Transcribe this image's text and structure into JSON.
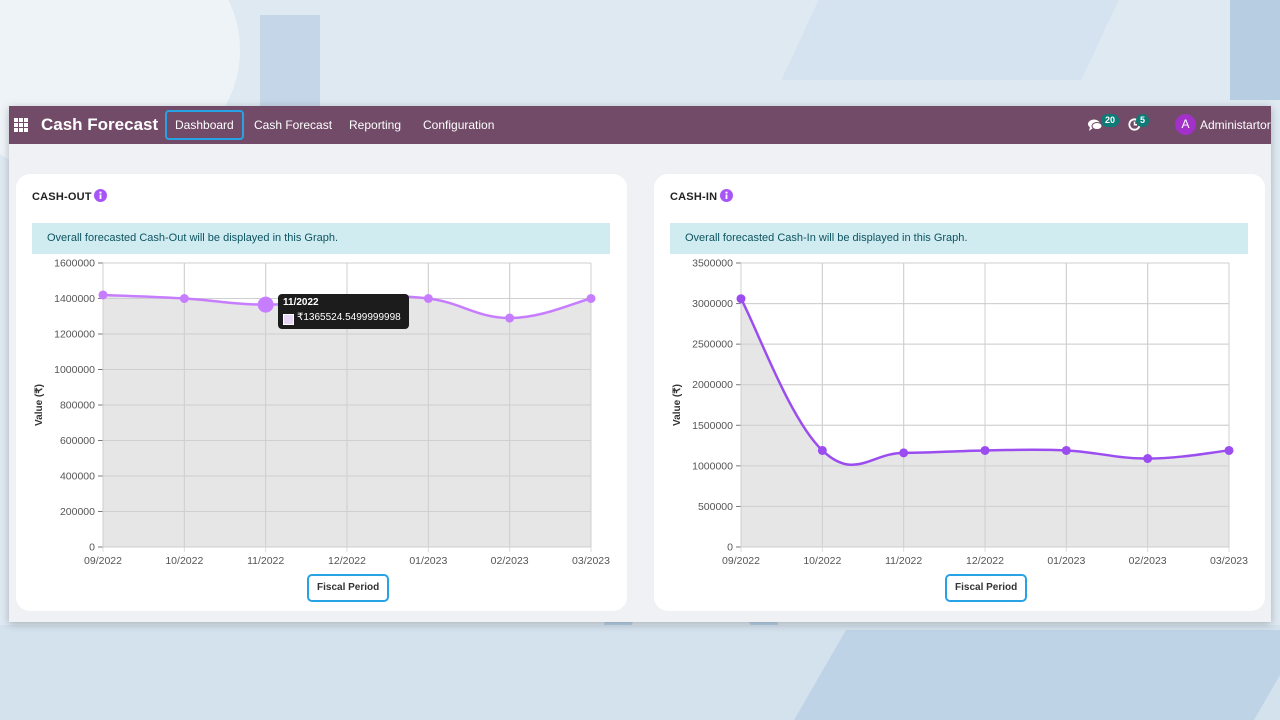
{
  "navbar": {
    "app_title": "Cash Forecast",
    "menu": [
      {
        "label": "Dashboard",
        "active": true
      },
      {
        "label": "Cash Forecast",
        "active": false
      },
      {
        "label": "Reporting",
        "active": false
      },
      {
        "label": "Configuration",
        "active": false
      }
    ],
    "messages_count": "20",
    "activities_count": "5",
    "user_initial": "A",
    "user_name": "Administartor",
    "bar_color": "#714b67",
    "avatar_color": "#a230c9",
    "badge_color": "#0d7b76"
  },
  "cash_out": {
    "title": "CASH-OUT",
    "info_icon": "info-circle-icon",
    "alert": "Overall forecasted Cash-Out will be displayed in this Graph.",
    "tooltip": {
      "title": "11/2022",
      "value": "₹1365524.5499999998"
    }
  },
  "cash_in": {
    "title": "CASH-IN",
    "info_icon": "info-circle-icon",
    "alert": "Overall forecasted Cash-In will be displayed in this Graph."
  },
  "chart_data": [
    {
      "type": "line",
      "x": [
        "09/2022",
        "10/2022",
        "11/2022",
        "12/2022",
        "01/2023",
        "02/2023",
        "03/2023"
      ],
      "values": [
        1420000,
        1400000,
        1365524.55,
        1400000,
        1400000,
        1290000,
        1400000
      ],
      "xlabel": "Fiscal Period",
      "ylabel": "Value (₹)",
      "ylim": [
        0,
        1600000
      ],
      "yticks": [
        0,
        200000,
        400000,
        600000,
        800000,
        1000000,
        1200000,
        1400000,
        1600000
      ],
      "line_color": "#c77dff",
      "fill_color": "#e3e3e3",
      "grid": true
    },
    {
      "type": "line",
      "x": [
        "09/2022",
        "10/2022",
        "11/2022",
        "12/2022",
        "01/2023",
        "02/2023",
        "03/2023"
      ],
      "values": [
        3060000,
        1190000,
        1160000,
        1190000,
        1190000,
        1090000,
        1190000
      ],
      "xlabel": "Fiscal Period",
      "ylabel": "Value (₹)",
      "ylim": [
        0,
        3500000
      ],
      "yticks": [
        0,
        500000,
        1000000,
        1500000,
        2000000,
        2500000,
        3000000,
        3500000
      ],
      "line_color": "#9b4df0",
      "fill_color": "#e3e3e3",
      "grid": true
    }
  ]
}
